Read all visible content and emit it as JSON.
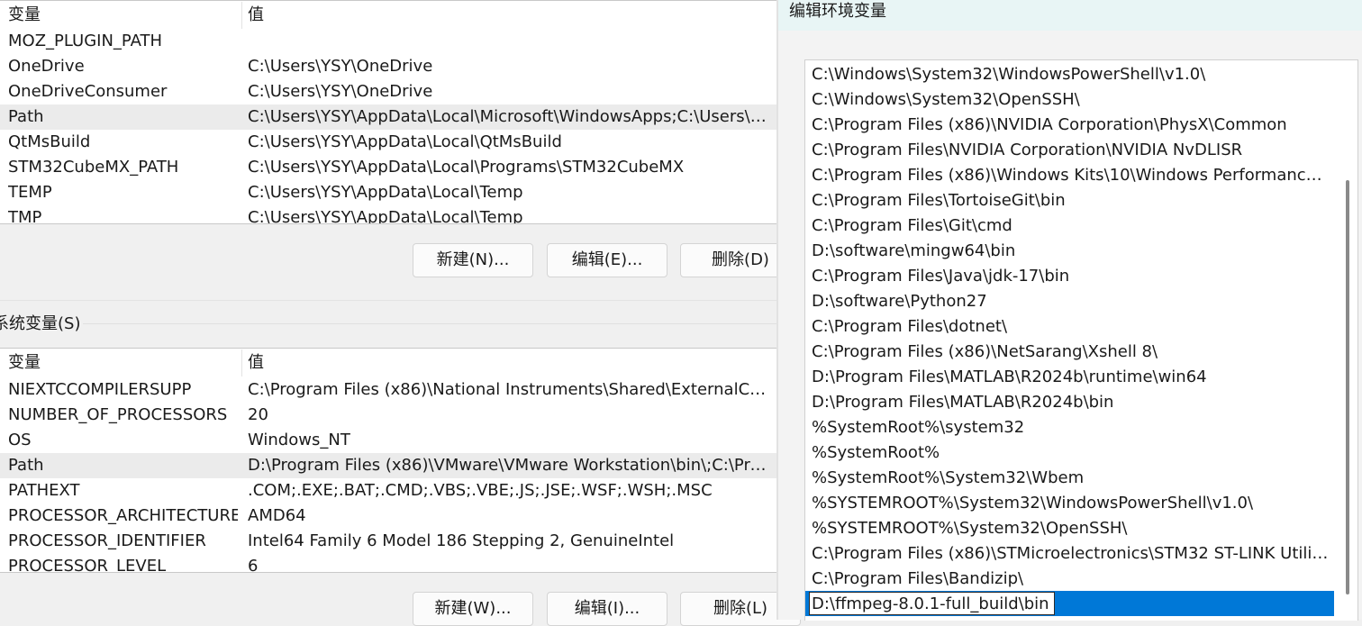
{
  "user_vars": {
    "header": {
      "name": "变量",
      "value": "值"
    },
    "rows": [
      {
        "name": "MOZ_PLUGIN_PATH",
        "value": ""
      },
      {
        "name": "OneDrive",
        "value": "C:\\Users\\YSY\\OneDrive"
      },
      {
        "name": "OneDriveConsumer",
        "value": "C:\\Users\\YSY\\OneDrive"
      },
      {
        "name": "Path",
        "value": "C:\\Users\\YSY\\AppData\\Local\\Microsoft\\WindowsApps;C:\\Users\\YS..."
      },
      {
        "name": "QtMsBuild",
        "value": "C:\\Users\\YSY\\AppData\\Local\\QtMsBuild"
      },
      {
        "name": "STM32CubeMX_PATH",
        "value": "C:\\Users\\YSY\\AppData\\Local\\Programs\\STM32CubeMX"
      },
      {
        "name": "TEMP",
        "value": "C:\\Users\\YSY\\AppData\\Local\\Temp"
      },
      {
        "name": "TMP",
        "value": "C:\\Users\\YSY\\AppData\\Local\\Temp"
      }
    ],
    "selected": "Path",
    "buttons": {
      "new": "新建(N)...",
      "edit": "编辑(E)...",
      "delete": "删除(D)"
    }
  },
  "system_vars": {
    "label": "系统变量(S)",
    "header": {
      "name": "变量",
      "value": "值"
    },
    "rows": [
      {
        "name": "NIEXTCCOMPILERSUPP",
        "value": "C:\\Program Files (x86)\\National Instruments\\Shared\\ExternalCom..."
      },
      {
        "name": "NUMBER_OF_PROCESSORS",
        "value": "20"
      },
      {
        "name": "OS",
        "value": "Windows_NT"
      },
      {
        "name": "Path",
        "value": "D:\\Program Files (x86)\\VMware\\VMware Workstation\\bin\\;C:\\Prog..."
      },
      {
        "name": "PATHEXT",
        "value": ".COM;.EXE;.BAT;.CMD;.VBS;.VBE;.JS;.JSE;.WSF;.WSH;.MSC"
      },
      {
        "name": "PROCESSOR_ARCHITECTURE",
        "value": "AMD64"
      },
      {
        "name": "PROCESSOR_IDENTIFIER",
        "value": "Intel64 Family 6 Model 186 Stepping 2, GenuineIntel"
      },
      {
        "name": "PROCESSOR_LEVEL",
        "value": "6"
      }
    ],
    "selected": "Path",
    "buttons": {
      "new": "新建(W)...",
      "edit": "编辑(I)...",
      "delete": "删除(L)"
    }
  },
  "edit_dialog": {
    "title": "编辑环境变量",
    "paths": [
      "C:\\Windows\\System32\\WindowsPowerShell\\v1.0\\",
      "C:\\Windows\\System32\\OpenSSH\\",
      "C:\\Program Files (x86)\\NVIDIA Corporation\\PhysX\\Common",
      "C:\\Program Files\\NVIDIA Corporation\\NVIDIA NvDLISR",
      "C:\\Program Files (x86)\\Windows Kits\\10\\Windows Performance To...",
      "C:\\Program Files\\TortoiseGit\\bin",
      "C:\\Program Files\\Git\\cmd",
      "D:\\software\\mingw64\\bin",
      "C:\\Program Files\\Java\\jdk-17\\bin",
      "D:\\software\\Python27",
      "C:\\Program Files\\dotnet\\",
      "C:\\Program Files (x86)\\NetSarang\\Xshell 8\\",
      "D:\\Program Files\\MATLAB\\R2024b\\runtime\\win64",
      "D:\\Program Files\\MATLAB\\R2024b\\bin",
      "%SystemRoot%\\system32",
      "%SystemRoot%",
      "%SystemRoot%\\System32\\Wbem",
      "%SYSTEMROOT%\\System32\\WindowsPowerShell\\v1.0\\",
      "%SYSTEMROOT%\\System32\\OpenSSH\\",
      "C:\\Program Files (x86)\\STMicroelectronics\\STM32 ST-LINK Utility\\...",
      "C:\\Program Files\\Bandizip\\"
    ],
    "editing_value": "D:\\ffmpeg-8.0.1-full_build\\bin"
  }
}
